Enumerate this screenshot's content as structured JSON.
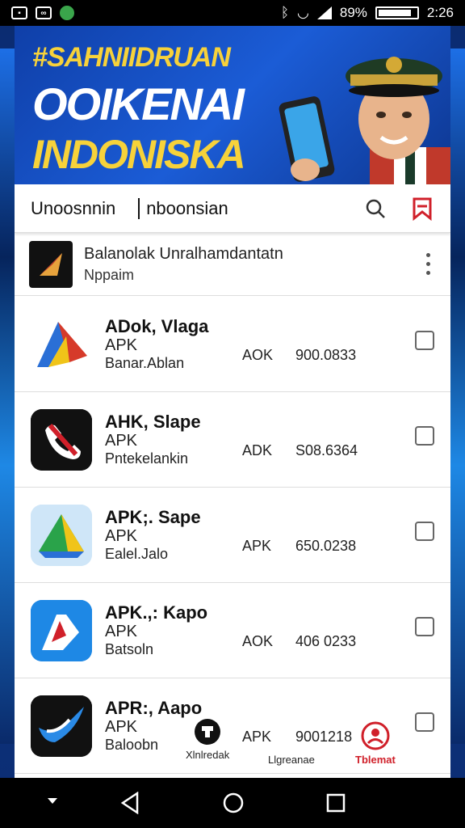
{
  "status_bar": {
    "battery": "89%",
    "time": "2:26",
    "left_icons": [
      "photo-icon",
      "app-icon",
      "whatsapp-icon"
    ]
  },
  "banner": {
    "line1": "#SAHNIIDRUAN",
    "line2": "OOIKENAI",
    "line3": "INDONISKA"
  },
  "toolbar": {
    "title": "Unoosnnin",
    "subtitle": "nboonsian",
    "icons": [
      "search-icon",
      "bookmark-icon"
    ]
  },
  "featured": {
    "title": "Balanolak Unralhamdantatn",
    "subtitle": "Nppaim"
  },
  "apps": [
    {
      "name": "ADok, Vlaga",
      "type": "APK",
      "developer": "Banar.Ablan",
      "tag": "AOK",
      "size": "900.0833",
      "icon": "red-blue-logo-icon"
    },
    {
      "name": "AHK, Slape",
      "type": "APK",
      "developer": "Pntekelankin",
      "tag": "ADK",
      "size": "S08.6364",
      "icon": "phone-logo-icon"
    },
    {
      "name": "APK;. Sape",
      "type": "APK",
      "developer": "Ealel.Jalo",
      "tag": "APK",
      "size": "650.0238",
      "icon": "triangle-logo-icon"
    },
    {
      "name": "APK.,: Kapo",
      "type": "APK",
      "developer": "Batsoln",
      "tag": "AOK",
      "size": "406 0233",
      "icon": "ap-logo-icon"
    },
    {
      "name": "APR:, Aapo",
      "type": "APK",
      "developer": "Baloobn",
      "tag": "APK",
      "size": "9001218",
      "icon": "bird-logo-icon"
    }
  ],
  "tabs": [
    {
      "label": "Xlnlredak",
      "icon": "home-icon",
      "active": false
    },
    {
      "label": "Llgreanae",
      "icon": "list-icon",
      "active": false
    },
    {
      "label": "Tblemat",
      "icon": "user-icon",
      "active": true
    }
  ],
  "nav": [
    "back-icon",
    "home-circle-icon",
    "recents-icon"
  ],
  "colors": {
    "accent": "#d0202a",
    "banner_blue": "#1b5cd6",
    "banner_yellow": "#f7d23a"
  }
}
